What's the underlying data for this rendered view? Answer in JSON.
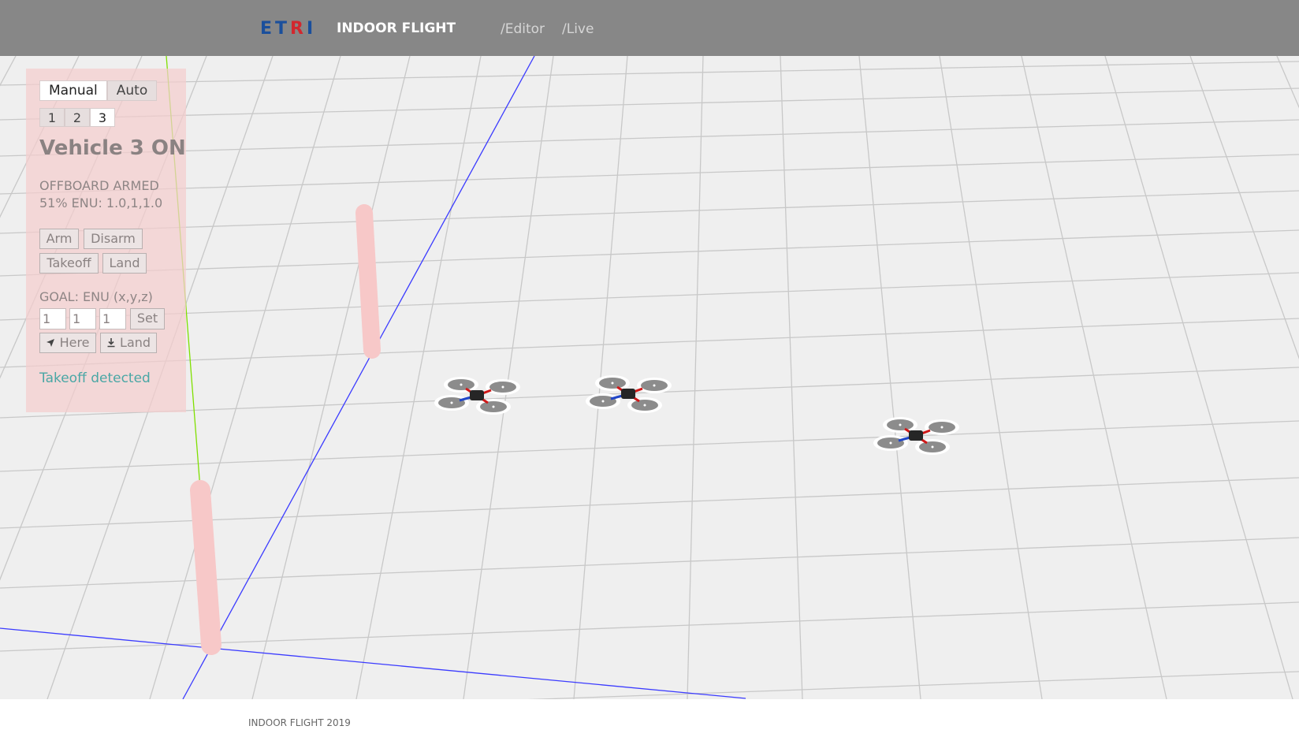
{
  "header": {
    "logo_text": "ETRI",
    "logo_blue": "ET",
    "logo_red": "R",
    "logo_blue2": "I",
    "title": "INDOOR FLIGHT",
    "nav": [
      {
        "label": "/Editor"
      },
      {
        "label": "/Live"
      }
    ]
  },
  "control_panel": {
    "mode_tabs": [
      {
        "label": "Manual",
        "active": true
      },
      {
        "label": "Auto",
        "active": false
      }
    ],
    "vehicle_tabs": [
      {
        "label": "1",
        "active": false
      },
      {
        "label": "2",
        "active": false
      },
      {
        "label": "3",
        "active": true
      }
    ],
    "vehicle_title": "Vehicle 3 ON",
    "mode_status": "OFFBOARD ARMED",
    "position_status": "51% ENU: 1.0,1,1.0",
    "buttons": {
      "arm": "Arm",
      "disarm": "Disarm",
      "takeoff": "Takeoff",
      "land": "Land"
    },
    "goal": {
      "label": "GOAL: ENU (x,y,z)",
      "x": "1",
      "y": "1",
      "z": "1",
      "set_label": "Set",
      "here_label": "Here",
      "goal_land_label": "Land"
    },
    "message": "Takeoff detected"
  },
  "scene": {
    "obstacle_color": "#f7c8c8",
    "axis_x_color": "#3b3bff",
    "axis_y_color": "#7fe000",
    "grid_color": "#c8c8c8",
    "drones": [
      {
        "name": "drone-1"
      },
      {
        "name": "drone-2"
      },
      {
        "name": "drone-3"
      }
    ]
  },
  "footer": {
    "text": "INDOOR FLIGHT 2019"
  },
  "colors": {
    "navbar": "#878787",
    "panel": "#f4cdcd",
    "message": "#4aa7a5",
    "logo_blue": "#1a4f9c",
    "logo_red": "#d2272e"
  }
}
